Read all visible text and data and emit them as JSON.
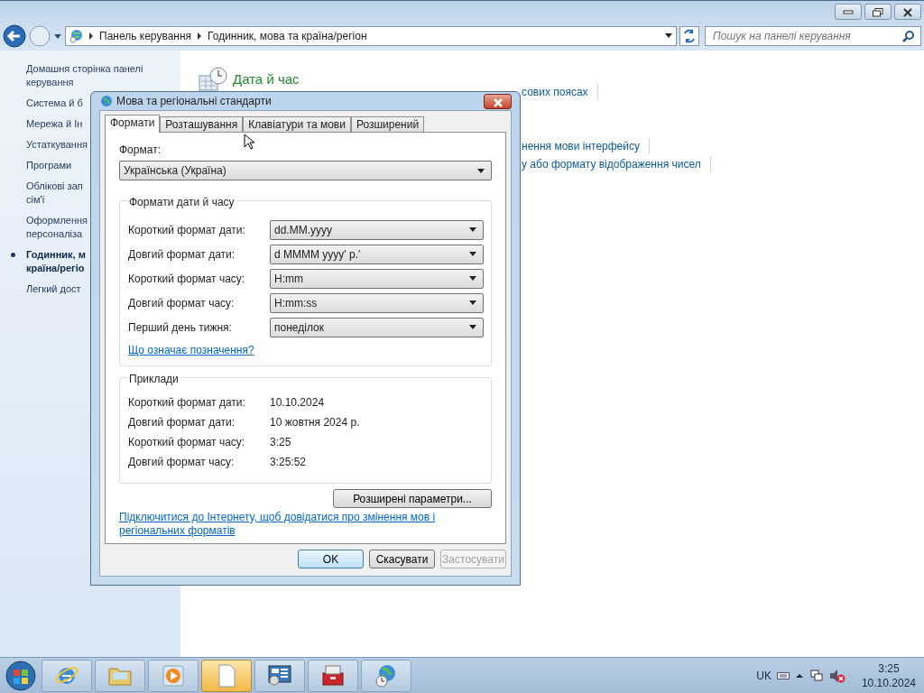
{
  "window": {
    "breadcrumbs": [
      "Панель керування",
      "Годинник, мова та країна/регіон"
    ],
    "search": {
      "placeholder": "Пошук на панелі керування"
    }
  },
  "sidebar": {
    "items": [
      {
        "lines": [
          "Домашня сторінка панелі",
          "керування"
        ],
        "selected": false
      },
      {
        "lines": [
          "Система й б"
        ],
        "selected": false
      },
      {
        "lines": [
          "Мережа й Ін"
        ],
        "selected": false
      },
      {
        "lines": [
          "Устаткування"
        ],
        "selected": false
      },
      {
        "lines": [
          "Програми"
        ],
        "selected": false
      },
      {
        "lines": [
          "Облікові зап",
          "сім'ї"
        ],
        "selected": false
      },
      {
        "lines": [
          "Оформлення",
          "персоналіза"
        ],
        "selected": false
      },
      {
        "lines": [
          "Годинник, м",
          "країна/регіо"
        ],
        "selected": true
      },
      {
        "lines": [
          "Легкий дост"
        ],
        "selected": false
      }
    ]
  },
  "main": {
    "category": "Дата й час",
    "links": [
      {
        "text": "сових поясах"
      },
      {
        "text": "нення мови інтерфейсу"
      },
      {
        "text": "у або формату відображення чисел"
      }
    ]
  },
  "dialog": {
    "title": "Мова та регіональні стандарти",
    "tabs": [
      {
        "label": "Формати",
        "selected": true
      },
      {
        "label": "Розташування",
        "selected": false
      },
      {
        "label": "Клавіатури та мови",
        "selected": false
      },
      {
        "label": "Розширений",
        "selected": false
      }
    ],
    "format_label": "Формат:",
    "format_value": "Українська (Україна)",
    "formats_group": "Формати дати й часу",
    "formats": [
      {
        "label": "Короткий формат дати:",
        "value": "dd.MM.yyyy"
      },
      {
        "label": "Довгий формат дати:",
        "value": "d MMMM yyyy' р.'"
      },
      {
        "label": "Короткий формат часу:",
        "value": "H:mm"
      },
      {
        "label": "Довгий формат часу:",
        "value": "H:mm:ss"
      },
      {
        "label": "Перший день тижня:",
        "value": "понеділок"
      }
    ],
    "help_link": "Що означає позначення?",
    "examples_group": "Приклади",
    "examples": [
      {
        "label": "Короткий формат дати:",
        "value": "10.10.2024"
      },
      {
        "label": "Довгий формат дати:",
        "value": "10 жовтня 2024 р."
      },
      {
        "label": "Короткий формат часу:",
        "value": "3:25"
      },
      {
        "label": "Довгий формат часу:",
        "value": "3:25:52"
      }
    ],
    "advanced_button": "Розширені параметри...",
    "internet_link": "Підключитися до Інтернету, щоб довідатися про змінення мов і регіональних форматів",
    "buttons": [
      {
        "label": "OK",
        "default": true,
        "disabled": false
      },
      {
        "label": "Скасувати",
        "default": false,
        "disabled": false
      },
      {
        "label": "Застосувати",
        "default": false,
        "disabled": true
      }
    ]
  },
  "taskbar": {
    "items": [
      {
        "kind": "browser",
        "selected": false
      },
      {
        "kind": "folder",
        "selected": false
      },
      {
        "kind": "media",
        "selected": false
      },
      {
        "kind": "document",
        "selected": true
      },
      {
        "kind": "control-panel",
        "selected": false
      },
      {
        "kind": "toolbox",
        "selected": false
      },
      {
        "kind": "globe",
        "selected": false
      }
    ],
    "language": "UK",
    "time": "3:25",
    "date": "10.10.2024"
  }
}
